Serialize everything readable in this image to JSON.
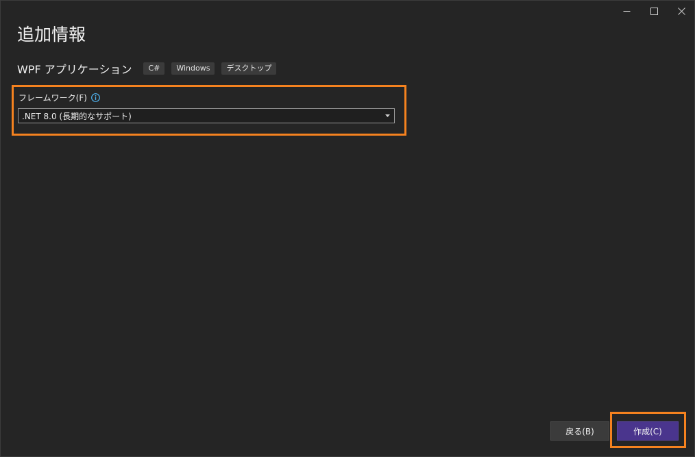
{
  "window": {
    "controls": {
      "minimize_icon": "minimize-icon",
      "maximize_icon": "maximize-icon",
      "close_icon": "close-icon"
    }
  },
  "dialog": {
    "title": "追加情報"
  },
  "template": {
    "name": "WPF アプリケーション",
    "tags": [
      "C#",
      "Windows",
      "デスクトップ"
    ]
  },
  "framework": {
    "label": "フレームワーク(F)",
    "info_icon": "info-icon",
    "selected": ".NET 8.0 (長期的なサポート)",
    "dropdown_icon": "chevron-down-icon"
  },
  "buttons": {
    "back": "戻る(B)",
    "create": "作成(C)"
  },
  "colors": {
    "background": "#252525",
    "highlight": "#f5821f",
    "primary_button": "#4a358d",
    "secondary_button": "#3b3b3b",
    "info_icon": "#4fb3f0"
  }
}
